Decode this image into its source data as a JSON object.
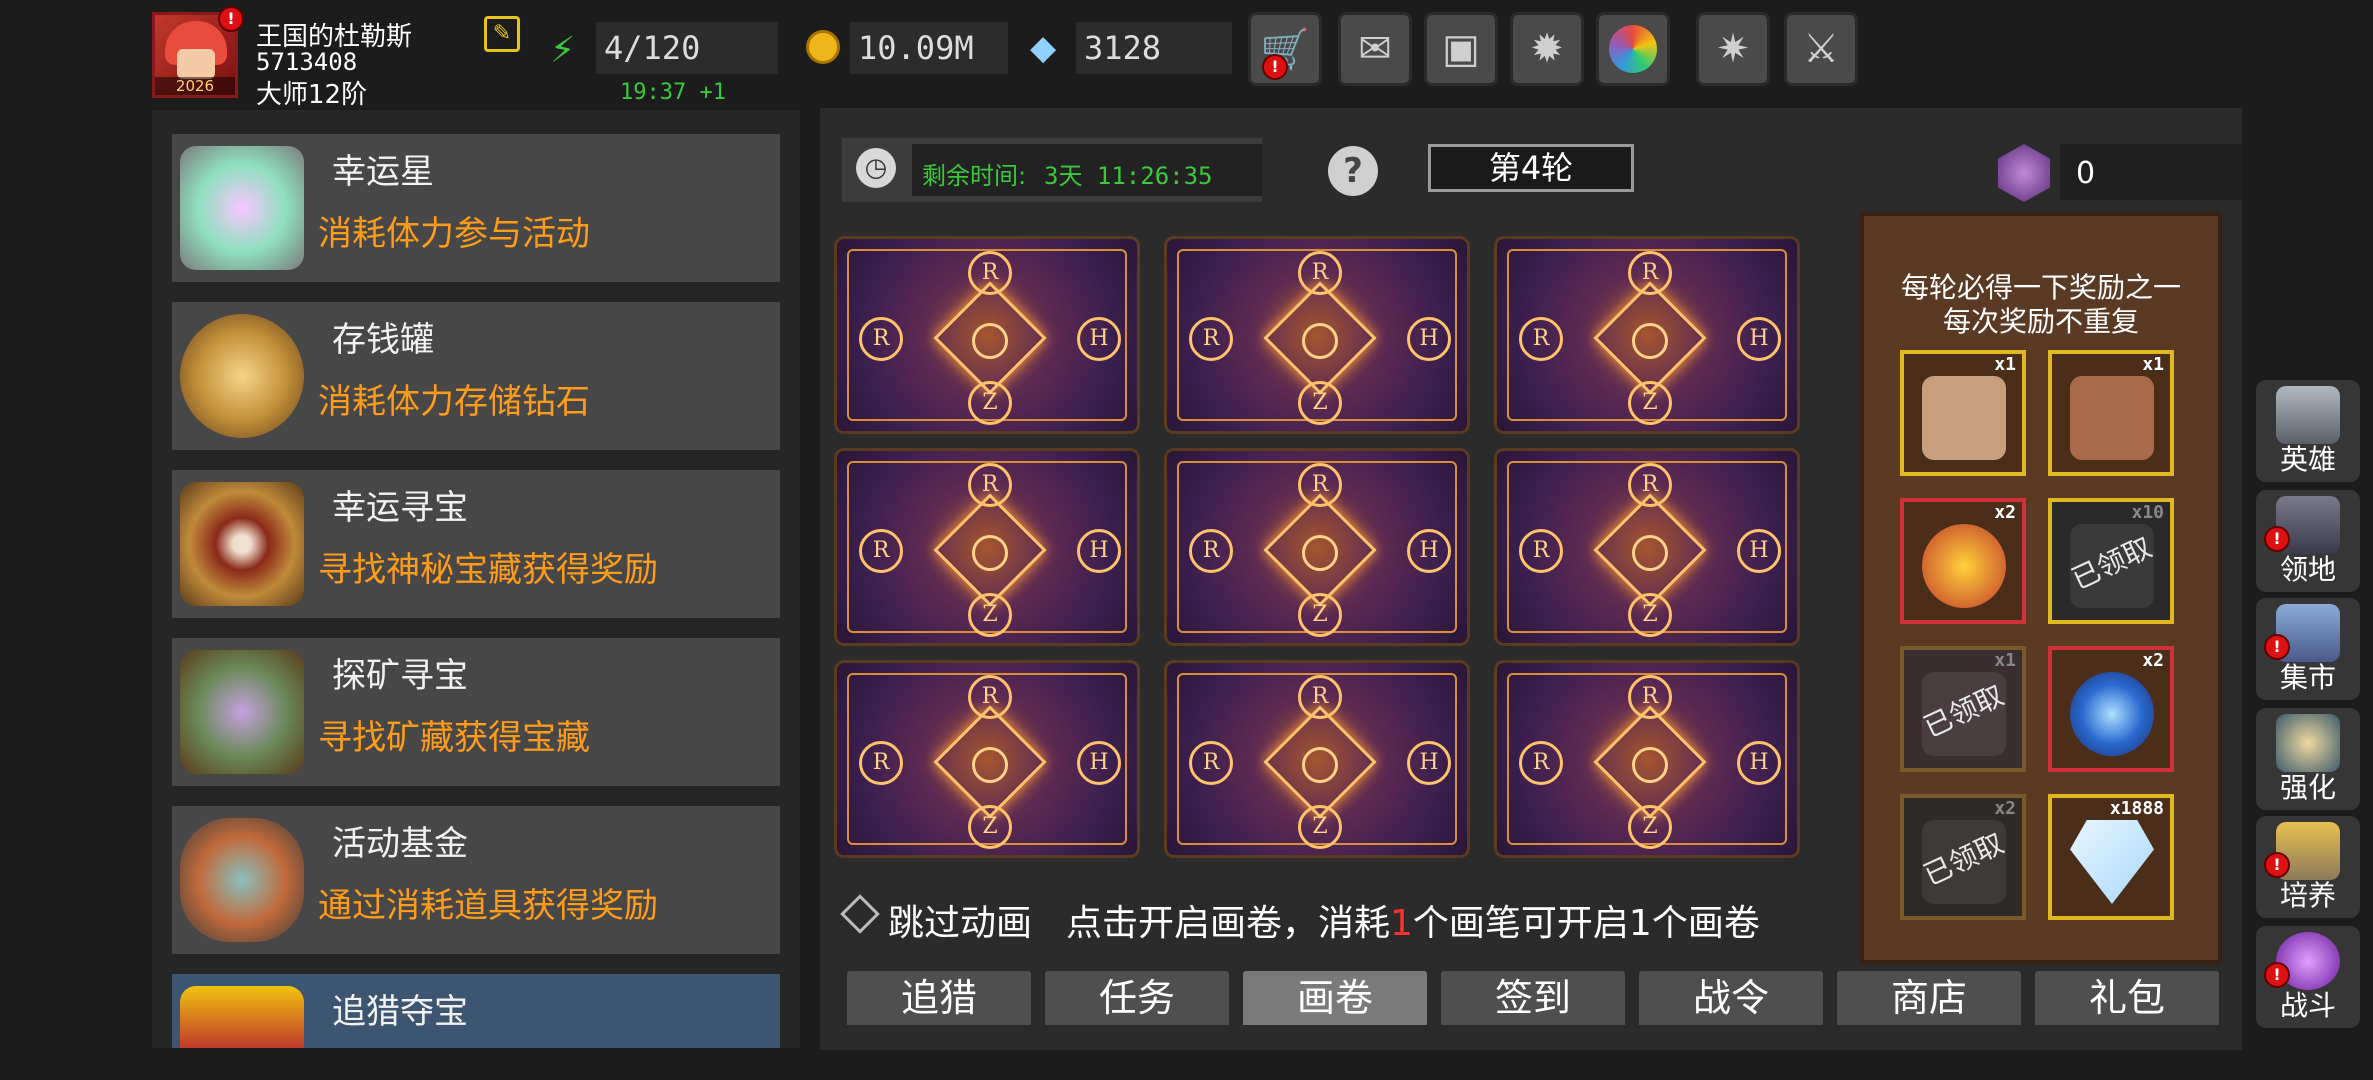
{
  "player": {
    "name": "王国的杜勒斯",
    "id": "5713408",
    "rank": "大师12阶",
    "avatar_year": "2026"
  },
  "resources": {
    "stamina": "4/120",
    "stamina_timer": "19:37 +1",
    "gold": "10.09M",
    "diamonds": "3128"
  },
  "top_icons": [
    "cart-icon",
    "mail-icon",
    "gamepad-icon",
    "gear-icon",
    "color-wheel-icon",
    "sparkle-icon",
    "crossed-swords-icon"
  ],
  "events": [
    {
      "title": "幸运星",
      "desc": "消耗体力参与活动",
      "icon": "lucky-star-icon"
    },
    {
      "title": "存钱罐",
      "desc": "消耗体力存储钻石",
      "icon": "piggy-bank-icon"
    },
    {
      "title": "幸运寻宝",
      "desc": "寻找神秘宝藏获得奖励",
      "icon": "treasure-map-icon"
    },
    {
      "title": "探矿寻宝",
      "desc": "寻找矿藏获得宝藏",
      "icon": "ore-chest-icon"
    },
    {
      "title": "活动基金",
      "desc": "通过消耗道具获得奖励",
      "icon": "money-bag-icon"
    },
    {
      "title": "追猎夺宝",
      "desc": "",
      "icon": "treasure-chest-icon"
    }
  ],
  "timer": {
    "label": "剩余时间:",
    "value": "3天 11:26:35"
  },
  "round_label": "第4轮",
  "crystal_count": "0",
  "reward_panel": {
    "line1": "每轮必得一下奖励之一",
    "line2": "每次奖励不重复",
    "claimed_text": "已领取",
    "items": [
      {
        "count": "x1",
        "border": "gold",
        "claimed": false,
        "icon": "mystery-scroll-icon"
      },
      {
        "count": "x1",
        "border": "gold",
        "claimed": false,
        "icon": "map-fragment-icon"
      },
      {
        "count": "x2",
        "border": "red",
        "claimed": false,
        "icon": "fire-orb-icon"
      },
      {
        "count": "x10",
        "border": "gold",
        "claimed": true,
        "icon": "scroll-icon"
      },
      {
        "count": "x1",
        "border": "brown",
        "claimed": true,
        "icon": "book-icon"
      },
      {
        "count": "x2",
        "border": "red",
        "claimed": false,
        "icon": "portal-gem-icon"
      },
      {
        "count": "x2",
        "border": "brown",
        "claimed": true,
        "icon": "tome-icon"
      },
      {
        "count": "x1888",
        "border": "gold",
        "claimed": false,
        "icon": "diamond-icon"
      }
    ]
  },
  "skip_label": "跳过动画",
  "instruction": {
    "part1": "点击开启画卷，消耗",
    "num": "1",
    "part2": "个画笔可开启1个画卷"
  },
  "tabs": [
    "追猎",
    "任务",
    "画卷",
    "签到",
    "战令",
    "商店",
    "礼包"
  ],
  "active_tab": "画卷",
  "side_nav": [
    "英雄",
    "领地",
    "集市",
    "强化",
    "培养",
    "战斗"
  ],
  "card_letters": {
    "top": "R",
    "left": "R",
    "right": "H",
    "bottom": "Z"
  }
}
